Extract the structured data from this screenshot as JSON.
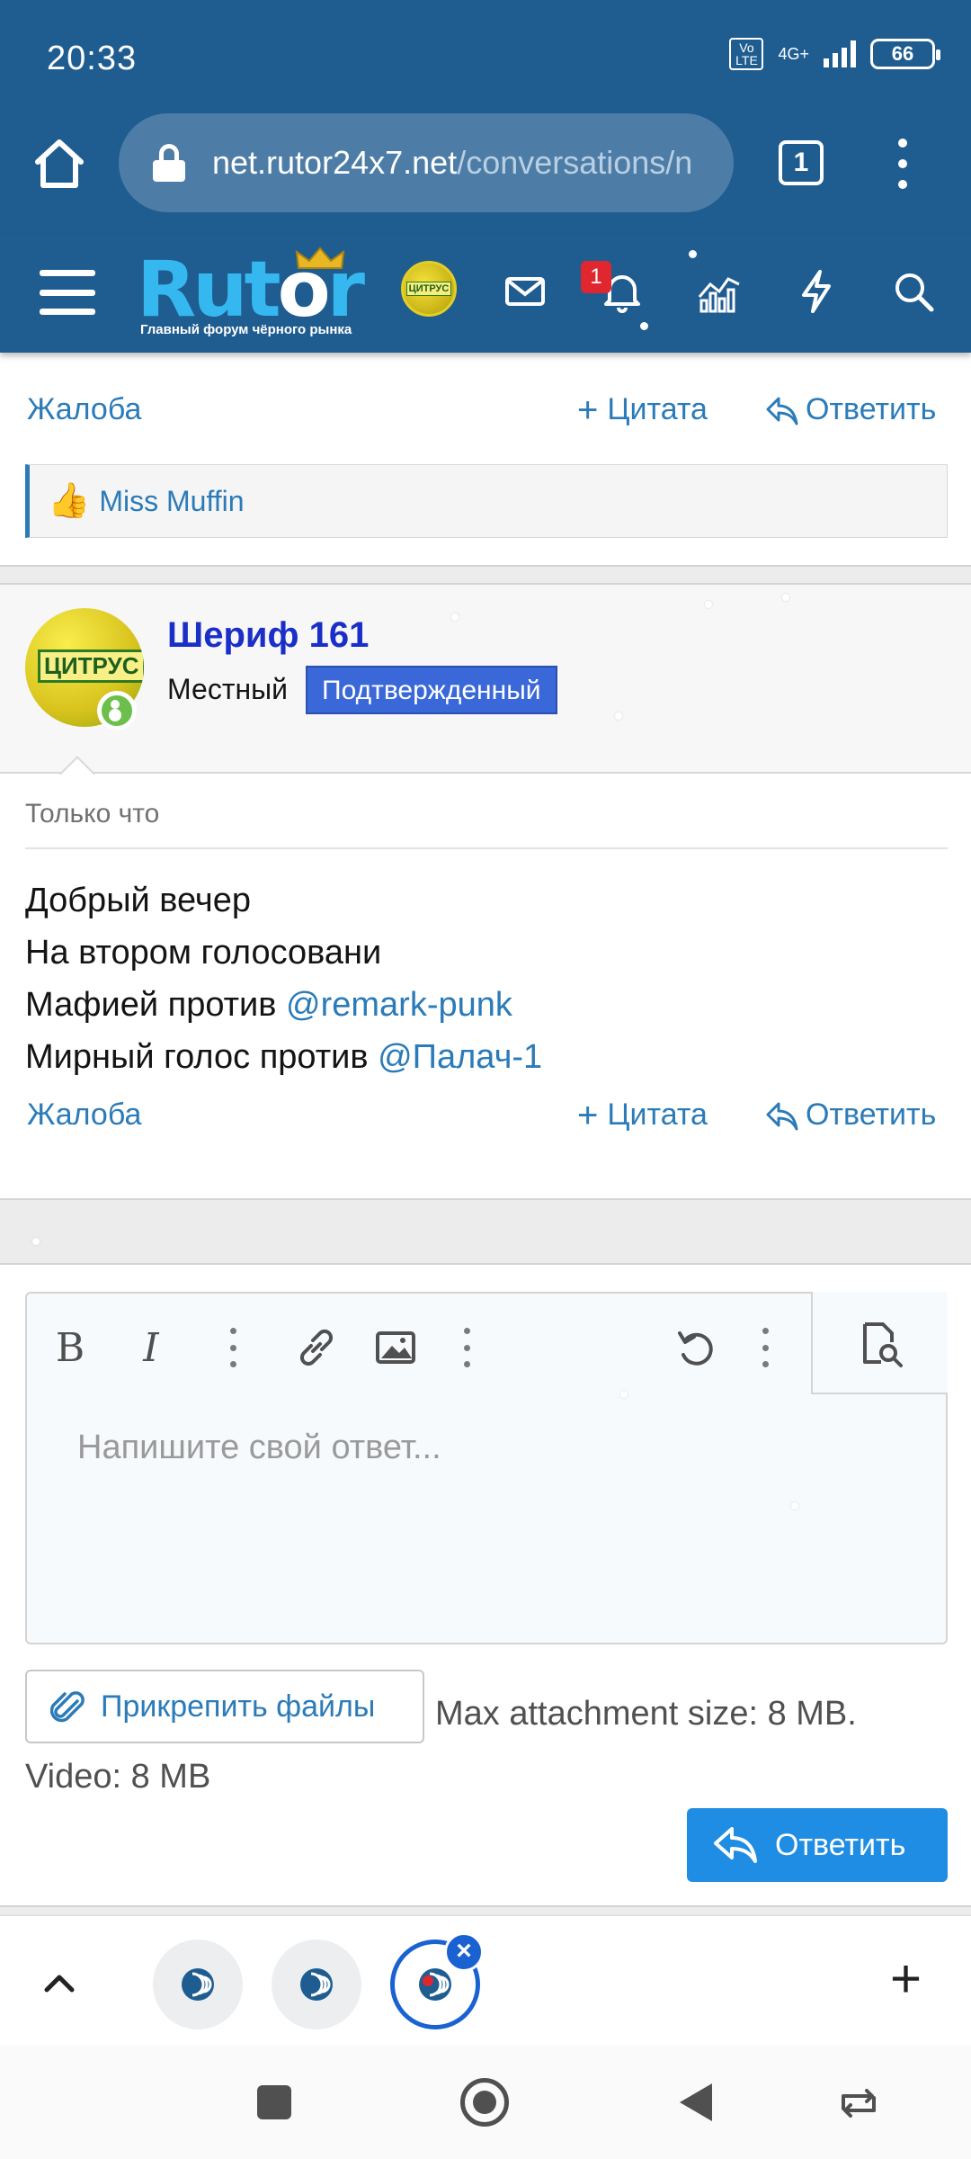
{
  "status_bar": {
    "time": "20:33",
    "volte": "Vo LTE",
    "network": "4G+",
    "battery": "66"
  },
  "browser": {
    "url_host": "net.rutor24x7.net",
    "url_path": "/conversations/n",
    "tabs_count": "1"
  },
  "forum_header": {
    "logo_text_a": "Rut",
    "logo_text_b": "r",
    "logo_tagline": "Главный форум чёрного рынка",
    "badge_text": "ЦИТРУС",
    "notifications_count": "1"
  },
  "prev_post_actions": {
    "report": "Жалоба",
    "quote": "Цитата",
    "reply": "Ответить"
  },
  "reactions": {
    "liked_by": "Miss Muffin"
  },
  "post": {
    "author": "Шериф 161",
    "role": "Местный",
    "badge": "Подтвержденный",
    "avatar_label": "ЦИТРУС",
    "time": "Только что",
    "lines": [
      {
        "text": "Добрый вечер",
        "mention": ""
      },
      {
        "text": "На втором голосовани",
        "mention": ""
      },
      {
        "text": "Мафией против ",
        "mention": "@remark-punk"
      },
      {
        "text": "Мирный голос против ",
        "mention": "@Палач-1"
      }
    ],
    "actions": {
      "report": "Жалоба",
      "quote": "Цитата",
      "reply": "Ответить"
    }
  },
  "editor": {
    "placeholder": "Напишите свой ответ...",
    "attach_label": "Прикрепить файлы",
    "attach_info": "Max attachment size: 8 MB. Video: 8 MB",
    "submit_label": "Ответить"
  },
  "colors": {
    "brand_blue": "#1f5d91",
    "link_blue": "#2b7bb9",
    "button_blue": "#1f8de3",
    "badge_blue": "#3a68d8",
    "author_blue": "#1a2ec8"
  }
}
